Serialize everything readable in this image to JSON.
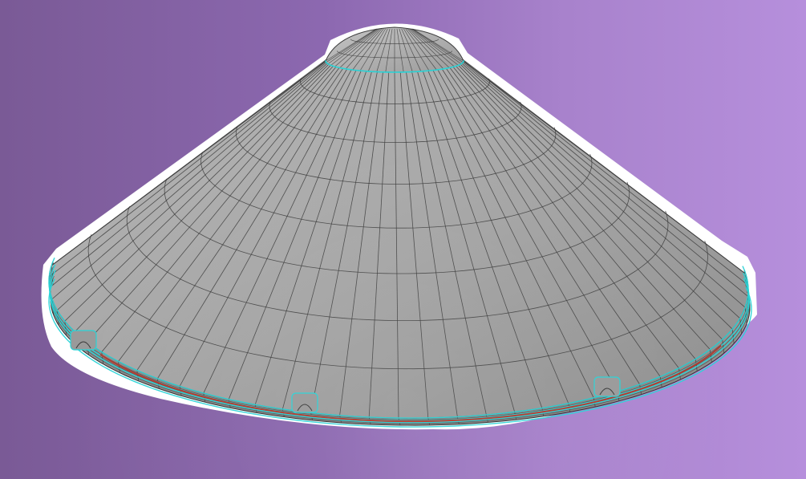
{
  "scene": {
    "subject": "cone-hat-wireframe-render",
    "colors": {
      "background_left": "#7a5a96",
      "background_right": "#b68fdc",
      "surface_light": "#b3b3b3",
      "surface_mid": "#a3a3a3",
      "surface_dark": "#8a8a8a",
      "wire": "#3b3b3b",
      "highlight_edge": "#29d3d6",
      "seam": "#b33a2e",
      "outline": "#ffffff"
    },
    "mesh": {
      "radial_segments": 40,
      "cone_rings": 8
    }
  }
}
